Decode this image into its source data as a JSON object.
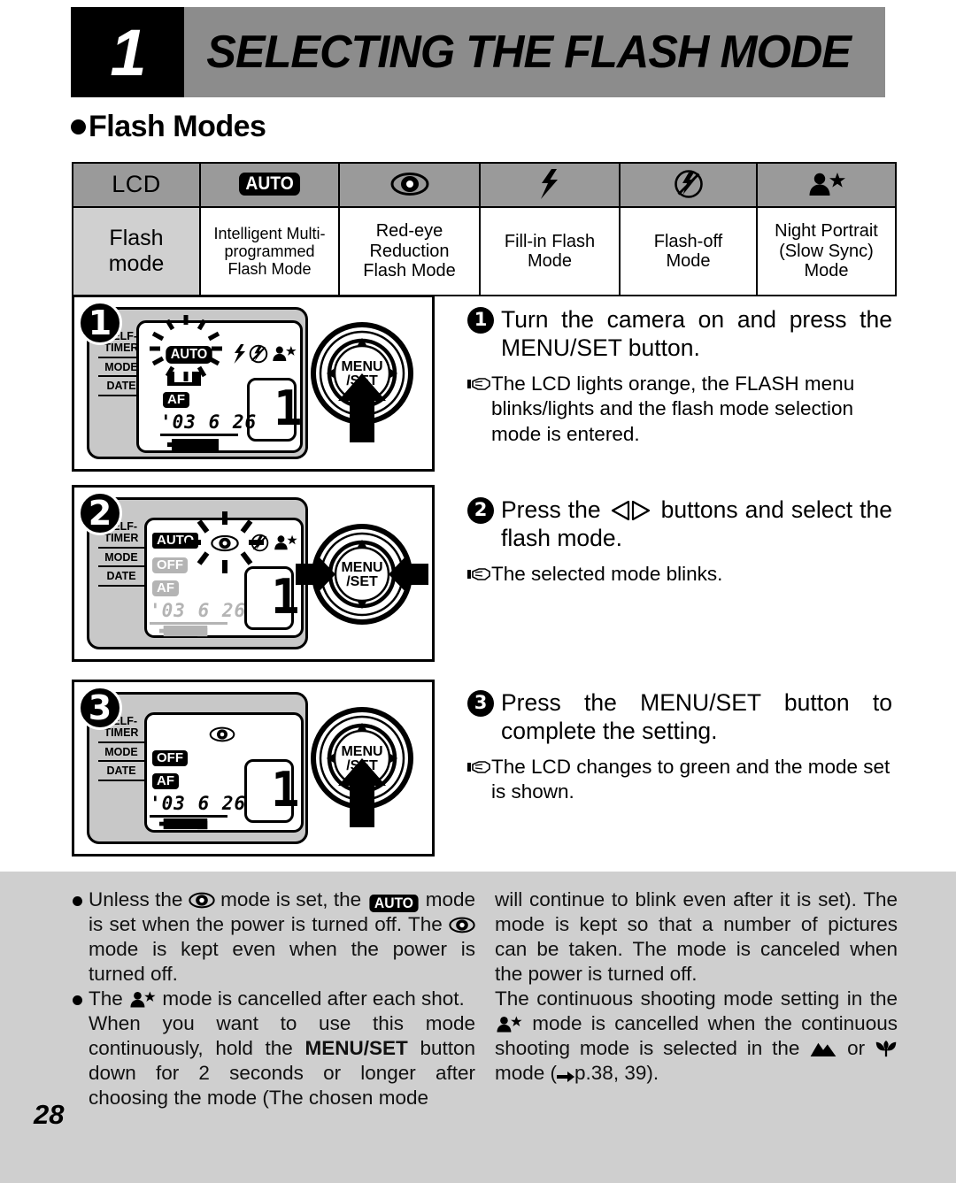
{
  "header": {
    "chapter_number": "1",
    "title": "SELECTING THE FLASH MODE"
  },
  "section": {
    "heading": "Flash Modes"
  },
  "table": {
    "row1_label": "LCD",
    "row2_label": "Flash\nmode",
    "row2_label_line1": "Flash",
    "row2_label_line2": "mode",
    "columns": [
      {
        "icon": "auto-badge-icon",
        "icon_text": "AUTO",
        "label_lines": [
          "Intelligent Multi-",
          "programmed",
          "Flash Mode"
        ]
      },
      {
        "icon": "red-eye-icon",
        "icon_text": "",
        "label_lines": [
          "Red-eye",
          "Reduction",
          "Flash Mode"
        ]
      },
      {
        "icon": "lightning-bolt-icon",
        "icon_text": "",
        "label_lines": [
          "Fill-in Flash",
          "Mode"
        ]
      },
      {
        "icon": "flash-off-icon",
        "icon_text": "",
        "label_lines": [
          "Flash-off",
          "Mode"
        ]
      },
      {
        "icon": "night-portrait-icon",
        "icon_text": "",
        "label_lines": [
          "Night Portrait",
          "(Slow Sync)",
          "Mode"
        ]
      }
    ]
  },
  "lcd_panel": {
    "side_labels": [
      "SELF-\nTIMER",
      "MODE",
      "DATE"
    ],
    "side_label_1a": "SELF-",
    "side_label_1b": "TIMER",
    "side_label_2": "MODE",
    "side_label_3": "DATE",
    "af_badge": "AF",
    "off_badge": "OFF",
    "auto_badge": "AUTO",
    "date_value": "'03  6 26",
    "frame_count": "1",
    "dial_center_line1": "MENU",
    "dial_center_line2": "/SET"
  },
  "steps": [
    {
      "number": "1",
      "badge": "1",
      "heading": "Turn the camera on and press the MENU/SET button.",
      "note": "The LCD lights orange, the FLASH menu blinks/lights and the flash mode selection mode is entered."
    },
    {
      "number": "2",
      "badge": "2",
      "heading_before": "Press the",
      "heading_after": "buttons and select the flash mode.",
      "note": "The selected mode blinks."
    },
    {
      "number": "3",
      "badge": "3",
      "heading": "Press the MENU/SET button to complete the setting.",
      "note": "The LCD changes to green and the mode set is shown."
    }
  ],
  "notes": {
    "left": {
      "item1_part1": "Unless the",
      "item1_part2": "mode is set, the",
      "item1_part3": "mode is set when the power is turned off. The",
      "item1_part4": "mode is kept even when the power is turned off.",
      "item1_auto": "AUTO",
      "item2_part1": "The",
      "item2_part2": "mode is cancelled after each shot.",
      "item2_cont": "When you want to use this mode continuously, hold the MENU/SET button down for 2 seconds or longer after choosing the mode (The chosen mode",
      "menu_set_bold": "MENU/SET"
    },
    "right": {
      "para1": "will continue to blink even after it is set). The mode is kept so that a number of pictures can be taken. The mode is canceled when the power is turned off.",
      "para2_part1": "The continuous shooting mode setting in the",
      "para2_part2": "mode is cancelled when the continuous shooting mode is selected in the",
      "para2_part3": "or",
      "para2_part4": "mode (",
      "page_ref": "p.38, 39",
      "para2_end": ")."
    }
  },
  "page_number": "28",
  "colors": {
    "header_band": "#8c8c8c",
    "chapter_block": "#000000",
    "table_header_row": "#9a9a9a",
    "table_first_col": "#d0d0d0",
    "notes_band": "#cfcfcf",
    "camera_body": "#c8c8c8",
    "dim_lcd": "#b4b4b4"
  }
}
